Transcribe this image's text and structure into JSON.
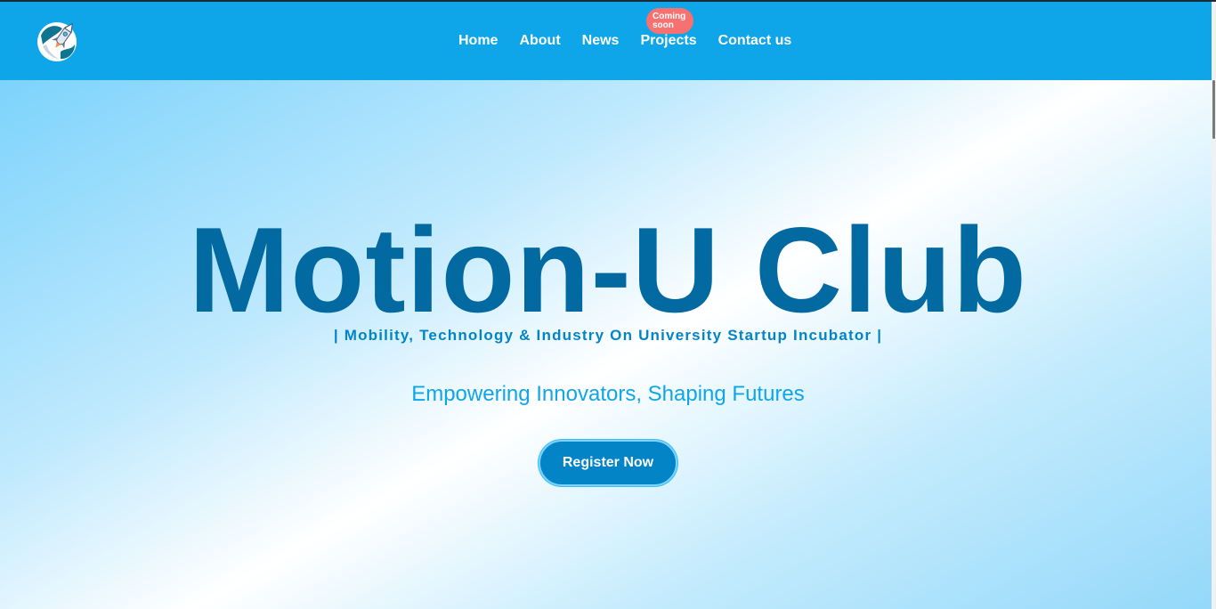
{
  "nav": {
    "logo_icon": "rocket-globe-icon",
    "links": [
      "Home",
      "About",
      "News",
      "Projects",
      "Contact us"
    ],
    "projects_badge": [
      "Coming",
      "soon"
    ]
  },
  "hero": {
    "title": "Motion-U Club",
    "tagline": "| Mobility, Technology & Industry On University Startup Incubator |",
    "subtitle": "Empowering Innovators, Shaping Futures",
    "cta_label": "Register Now"
  },
  "colors": {
    "nav_bg": "#0ea5e9",
    "title": "#0369a1",
    "tagline": "#0284c7",
    "subtitle": "#0ea5e9",
    "cta_bg": "#0284c7",
    "badge_bg": "#f87171"
  }
}
